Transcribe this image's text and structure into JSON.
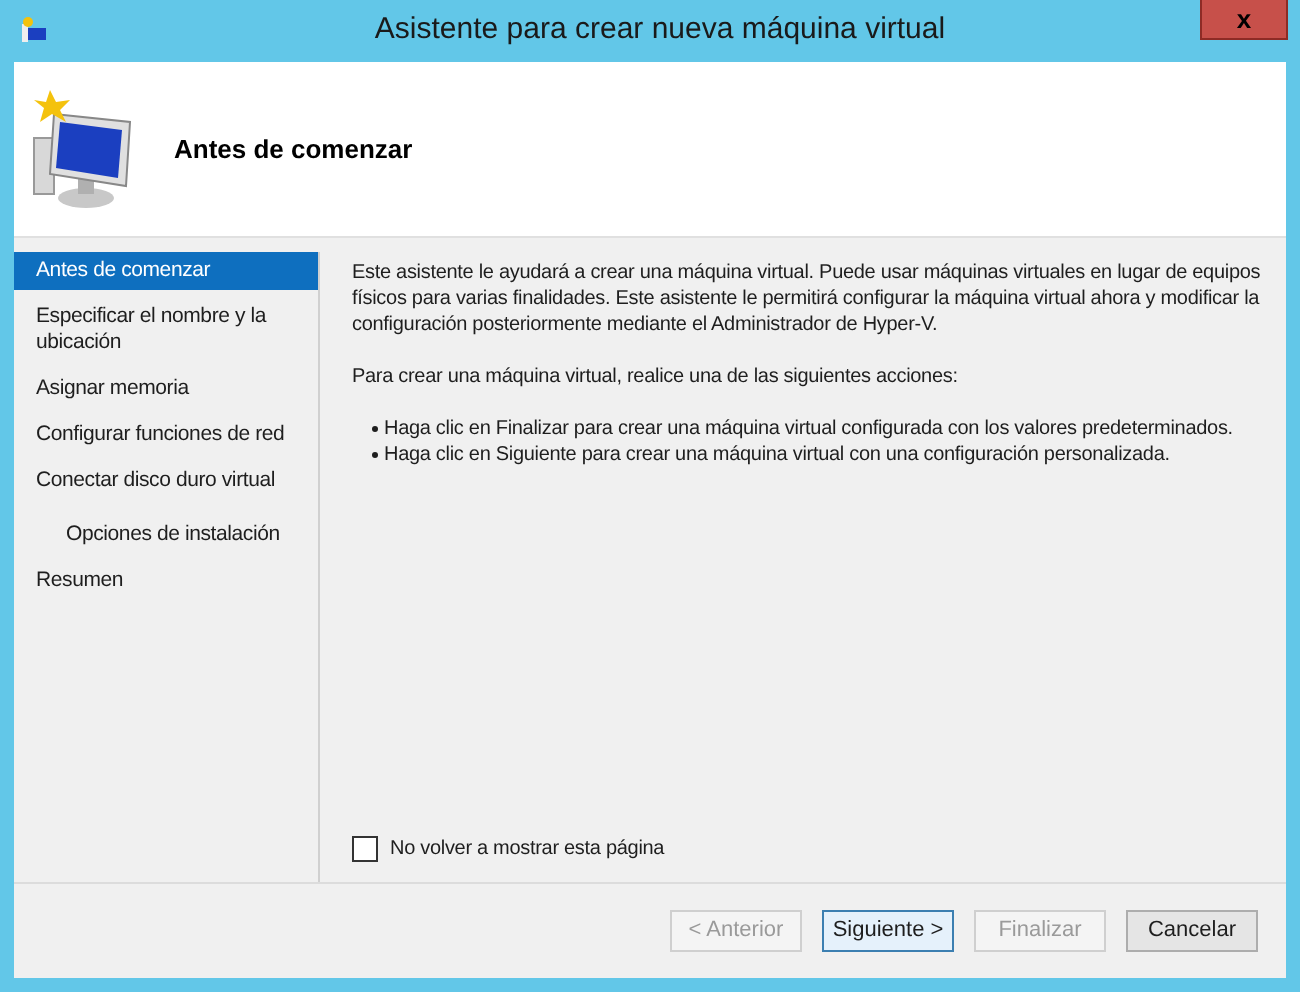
{
  "window": {
    "title": "Asistente para crear nueva máquina virtual",
    "close": "x"
  },
  "header": {
    "title": "Antes de comenzar"
  },
  "sidebar": {
    "items": [
      {
        "label": "Antes de comenzar",
        "selected": true
      },
      {
        "label": "Especificar el nombre y la ubicación",
        "selected": false
      },
      {
        "label": "Asignar memoria",
        "selected": false
      },
      {
        "label": "Configurar funciones de red",
        "selected": false
      },
      {
        "label": "Conectar disco duro virtual",
        "selected": false,
        "children": [
          {
            "label": "Opciones de instalación",
            "selected": false
          }
        ]
      },
      {
        "label": "Resumen",
        "selected": false
      }
    ]
  },
  "content": {
    "paragraphs": [
      "Este asistente le ayudará a crear una máquina virtual. Puede usar máquinas virtuales en lugar de equipos físicos para varias finalidades. Este asistente le permitirá configurar la máquina virtual ahora y modificar la configuración posteriormente mediante el Administrador de Hyper-V.",
      "Para crear una máquina virtual, realice una de las siguientes acciones:"
    ],
    "bullets": [
      "Haga clic en Finalizar para crear una máquina virtual configurada con los valores predeterminados.",
      "Haga clic en Siguiente para crear una máquina virtual con una configuración personalizada."
    ]
  },
  "checkbox": {
    "label": "No volver a mostrar esta página",
    "checked": false
  },
  "buttons": [
    {
      "label": "< Anterior",
      "disabled": true,
      "default": false
    },
    {
      "label": "Siguiente >",
      "disabled": false,
      "default": true
    },
    {
      "label": "Finalizar",
      "disabled": true,
      "default": false
    },
    {
      "label": "Cancelar",
      "disabled": false,
      "default": false
    }
  ]
}
